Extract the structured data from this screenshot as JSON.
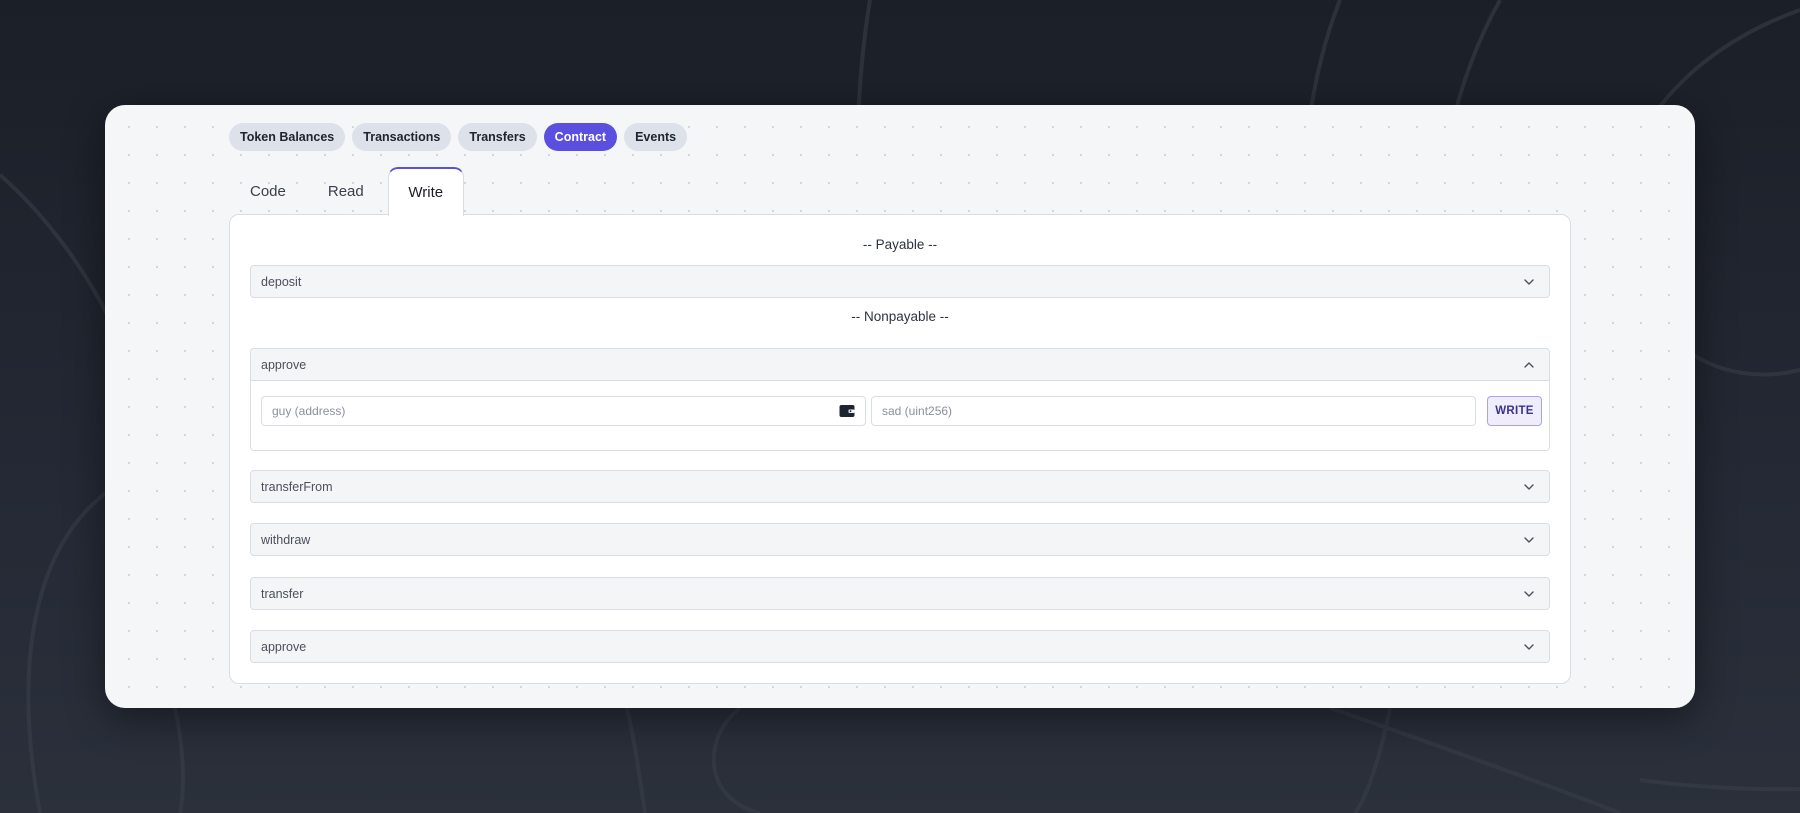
{
  "nav_pills": [
    {
      "label": "Token Balances",
      "active": false
    },
    {
      "label": "Transactions",
      "active": false
    },
    {
      "label": "Transfers",
      "active": false
    },
    {
      "label": "Contract",
      "active": true
    },
    {
      "label": "Events",
      "active": false
    }
  ],
  "tabs": [
    {
      "label": "Code",
      "active": false
    },
    {
      "label": "Read",
      "active": false
    },
    {
      "label": "Write",
      "active": true
    }
  ],
  "write_panel": {
    "payable_heading": "-- Payable --",
    "nonpayable_heading": "-- Nonpayable --",
    "payable_methods": [
      {
        "name": "deposit",
        "expanded": false
      }
    ],
    "nonpayable_methods": [
      {
        "name": "approve",
        "expanded": true
      },
      {
        "name": "transferFrom",
        "expanded": false
      },
      {
        "name": "withdraw",
        "expanded": false
      },
      {
        "name": "transfer",
        "expanded": false
      },
      {
        "name": "approve",
        "expanded": false
      }
    ],
    "approve_form": {
      "input_1_placeholder": "guy (address)",
      "input_2_placeholder": "sad (uint256)",
      "write_label": "WRITE"
    }
  },
  "colors": {
    "accent": "#5b4fe0",
    "page_bg": "#1b1f27",
    "card_bg": "#f5f6f8"
  },
  "icons": {
    "collapsed": "chevron-down-icon",
    "expanded": "chevron-up-icon",
    "address_helper": "wallet-icon"
  }
}
